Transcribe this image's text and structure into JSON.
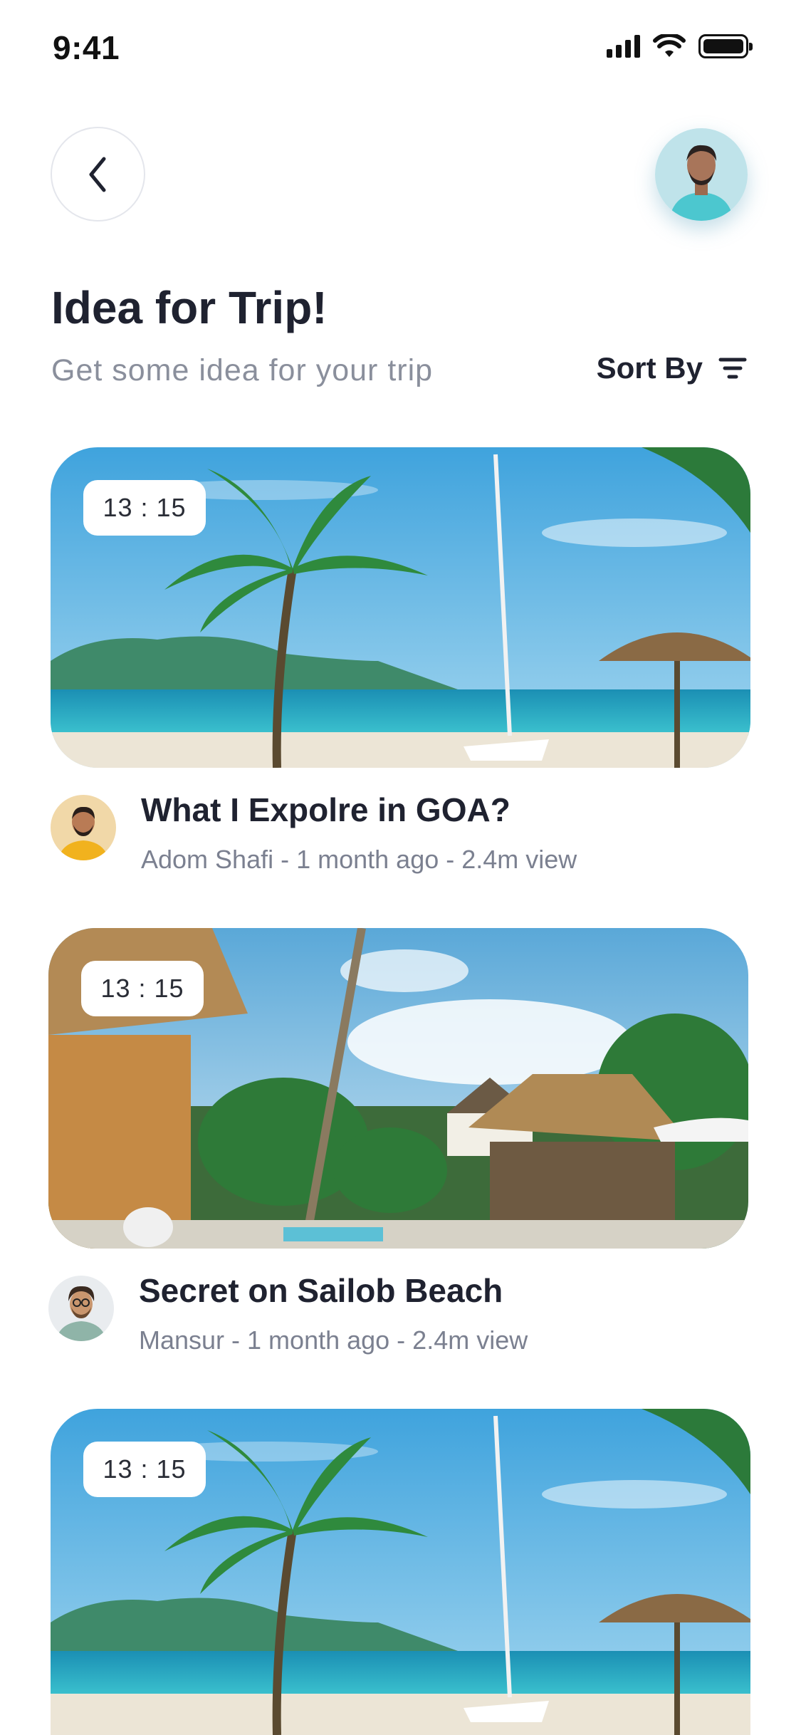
{
  "status_bar": {
    "time": "9:41"
  },
  "header": {
    "title": "Idea for Trip!",
    "subtitle": "Get some idea for your trip",
    "sort_label": "Sort By"
  },
  "posts": [
    {
      "duration": "13 : 15",
      "title": "What I Expolre in GOA?",
      "meta": "Adom Shafi - 1 month ago - 2.4m view"
    },
    {
      "duration": "13 : 15",
      "title": "Secret on Sailob Beach",
      "meta": "Mansur - 1 month ago - 2.4m view"
    },
    {
      "duration": "13 : 15",
      "title": "",
      "meta": ""
    }
  ],
  "icons": {
    "back": "chevron-left-icon",
    "sort": "filter-lines-icon",
    "signal": "cellular-signal-icon",
    "wifi": "wifi-icon",
    "battery": "battery-icon"
  },
  "colors": {
    "title": "#1f2230",
    "subtitle": "#8a8f9c",
    "badge_bg": "#ffffff",
    "sea": "#1f9fc0",
    "sky": "#5eb6e6"
  }
}
